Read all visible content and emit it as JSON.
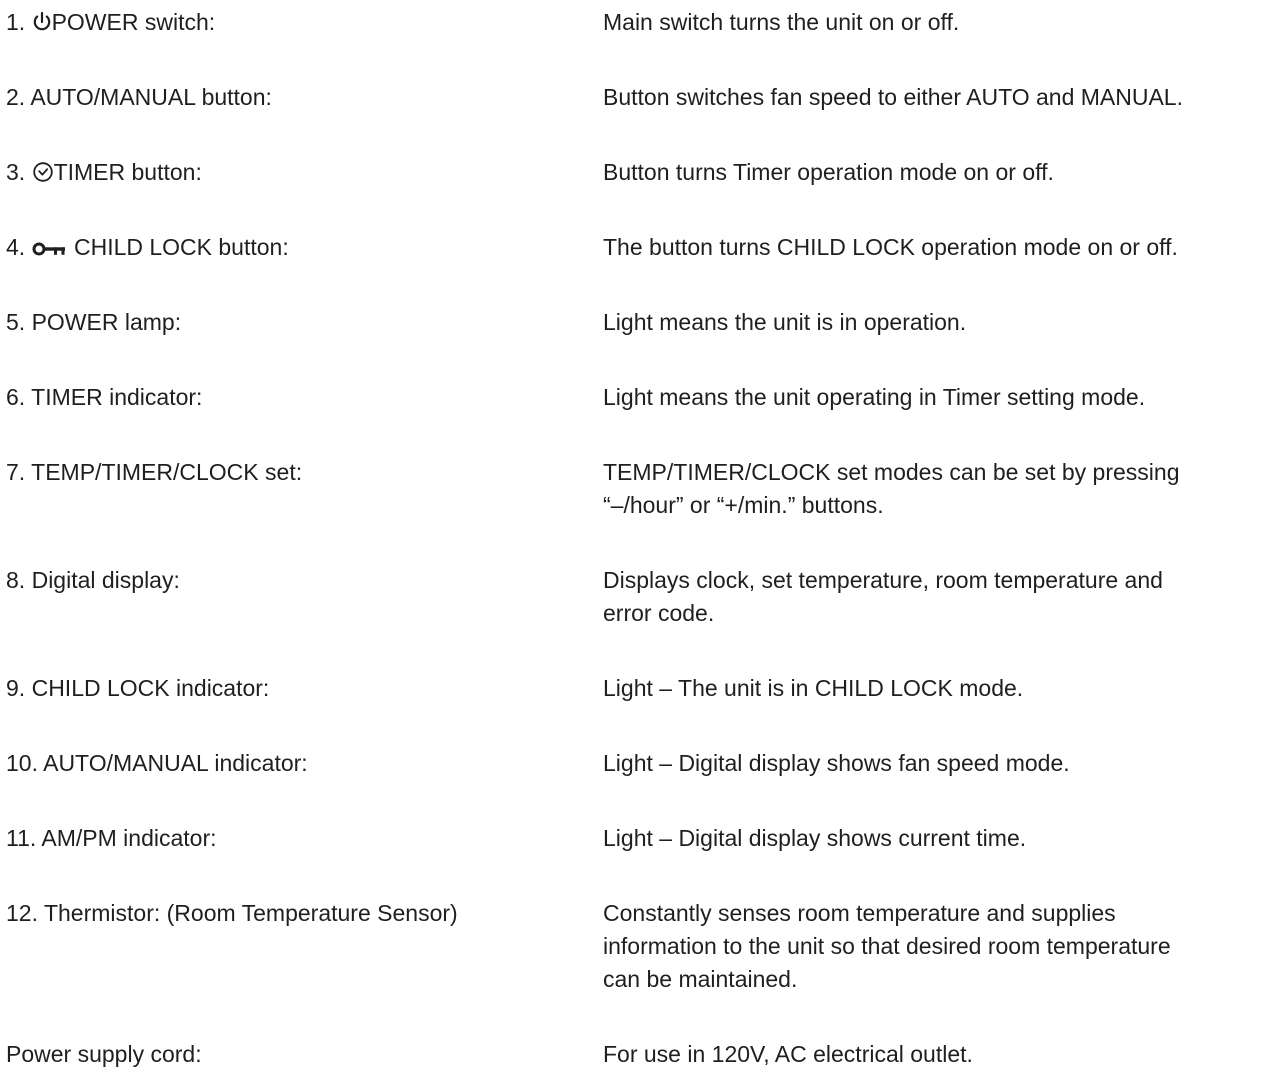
{
  "items": [
    {
      "number": "1.",
      "icon": "power-icon",
      "term": "POWER switch:",
      "description": "Main switch turns the unit on or off."
    },
    {
      "number": "2.",
      "term": "AUTO/MANUAL button:",
      "description": "Button switches fan speed to either AUTO and MANUAL."
    },
    {
      "number": "3.",
      "icon": "timer-icon",
      "term": "TIMER button:",
      "description": "Button turns Timer operation mode on or off."
    },
    {
      "number": "4.",
      "icon": "key-icon",
      "term": "CHILD LOCK button:",
      "description": "The button turns CHILD LOCK operation mode on or off."
    },
    {
      "number": "5.",
      "term": "POWER lamp:",
      "description": "Light means the unit is in operation."
    },
    {
      "number": "6.",
      "term": "TIMER indicator:",
      "description": "Light means the unit operating in Timer setting mode."
    },
    {
      "number": "7.",
      "term": "TEMP/TIMER/CLOCK set:",
      "description_lines": [
        "TEMP/TIMER/CLOCK set modes can be set by pressing",
        "“–/hour” or “+/min.” buttons."
      ]
    },
    {
      "number": "8.",
      "term": "Digital display:",
      "description_lines": [
        "Displays clock, set temperature, room temperature and",
        "error code."
      ]
    },
    {
      "number": "9.",
      "term": "CHILD LOCK indicator:",
      "description": "Light – The unit is in CHILD LOCK mode."
    },
    {
      "number": "10.",
      "term": "AUTO/MANUAL indicator:",
      "description": "Light – Digital display shows fan speed mode."
    },
    {
      "number": "11.",
      "term": "AM/PM indicator:",
      "description": "Light – Digital display shows current time."
    },
    {
      "number": "12.",
      "term": "Thermistor: (Room Temperature Sensor)",
      "description_lines": [
        "Constantly senses room temperature and supplies",
        "information to the unit so that desired room temperature",
        "can be maintained."
      ]
    },
    {
      "term": "Power supply cord:",
      "description": "For use in 120V, AC electrical outlet."
    }
  ]
}
